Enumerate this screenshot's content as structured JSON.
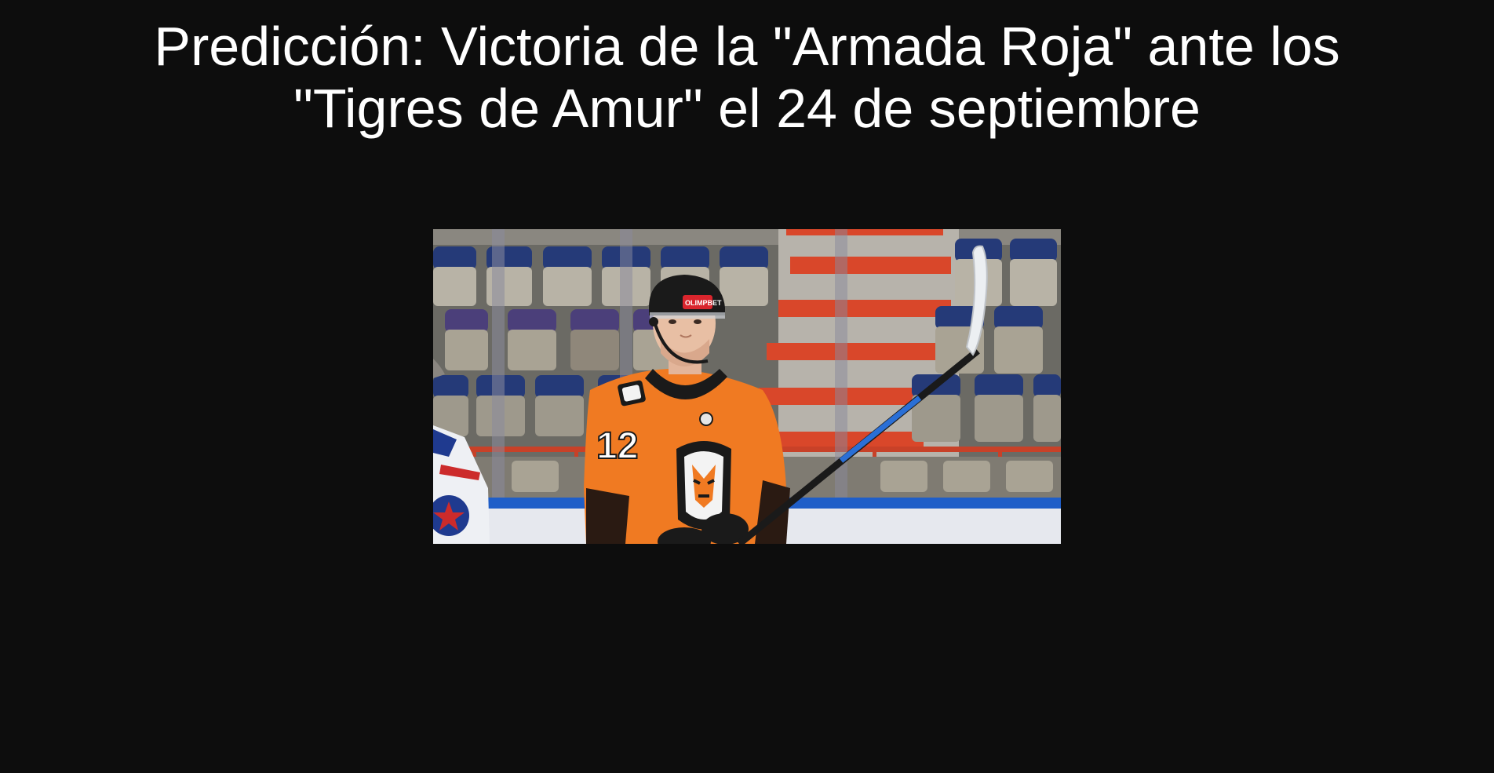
{
  "article": {
    "title": "Predicción: Victoria de la \"Armada Roja\" ante los \"Tigres de Amur\" el 24 de septiembre",
    "image_subject": "Hockey player in orange Amur Tigers jersey on ice with stick, arena seats in background"
  },
  "colors": {
    "background": "#0d0d0d",
    "title_text": "#ffffff",
    "jersey_orange": "#f07a22",
    "stair_red": "#d9472a",
    "seat_navy": "#233a7a"
  }
}
